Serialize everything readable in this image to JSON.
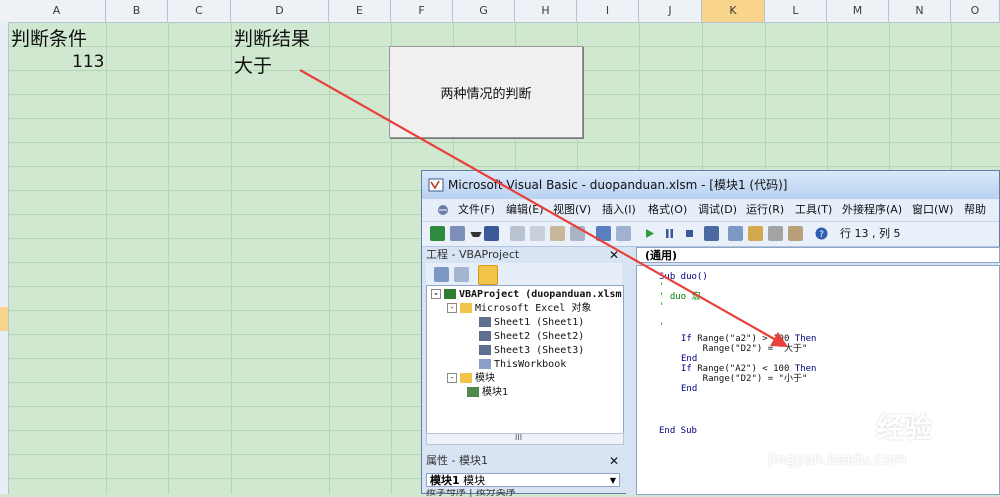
{
  "sheet": {
    "columns": [
      "A",
      "B",
      "C",
      "D",
      "E",
      "F",
      "G",
      "H",
      "I",
      "J",
      "K",
      "L",
      "M",
      "N",
      "O"
    ],
    "active_column": "K",
    "cells": {
      "a1": "判断条件",
      "a2": "113",
      "d1": "判断结果",
      "d2": "大于"
    },
    "button_label": "两种情况的判断"
  },
  "vba": {
    "title": "Microsoft Visual Basic - duopanduan.xlsm - [模块1 (代码)]",
    "menu": [
      "文件(F)",
      "编辑(E)",
      "视图(V)",
      "插入(I)",
      "格式(O)",
      "调试(D)",
      "运行(R)",
      "工具(T)",
      "外接程序(A)",
      "窗口(W)",
      "帮助(H)"
    ],
    "cursor_position": "行 13 , 列 5",
    "project_title": "工程 - VBAProject",
    "tree": {
      "root": "VBAProject (duopanduan.xlsm)",
      "excel_objects": "Microsoft Excel 对象",
      "sheet1": "Sheet1 (Sheet1)",
      "sheet2": "Sheet2 (Sheet2)",
      "sheet3": "Sheet3 (Sheet3)",
      "workbook": "ThisWorkbook",
      "modules": "模块",
      "module1": "模块1"
    },
    "hscroll_label": "III",
    "properties_title": "属性 - 模块1",
    "properties_object_name": "模块1",
    "properties_object_type": "模块",
    "properties_tabs": "按字母序 | 按分类序",
    "code_combo": "(通用)",
    "code": {
      "l1": "Sub duo()",
      "l2": "'",
      "l3": "' duo 宏",
      "l4": "'",
      "l5": "",
      "l6": "'",
      "l7a": "If",
      "l7b": " Range(\"a2\") > 100 ",
      "l7c": "Then",
      "l8": "    Range(\"D2\") = \"大于\"",
      "l9": "End",
      "l10a": "If",
      "l10b": " Range(\"A2\") < 100 ",
      "l10c": "Then",
      "l11": "    Range(\"D2\") = \"小于\"",
      "l12": "End",
      "l13": "End Sub"
    }
  },
  "watermark": {
    "brand_cn": "经验",
    "url": "jingyan.baidu.com"
  },
  "colors": {
    "sheet_bg": "#cfe8cf",
    "arrow": "#e8403a",
    "active_header": "#f9d48b"
  }
}
